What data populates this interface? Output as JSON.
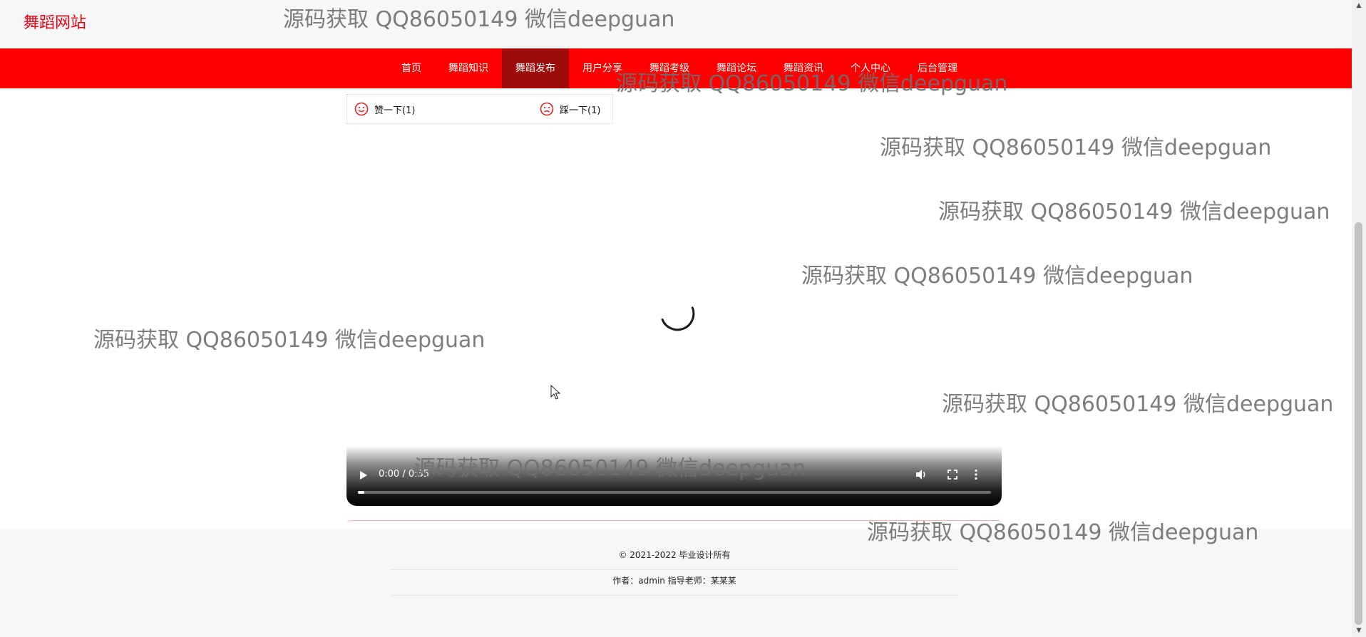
{
  "header": {
    "logo": "舞蹈网站"
  },
  "nav": {
    "items": [
      {
        "label": "首页",
        "active": false
      },
      {
        "label": "舞蹈知识",
        "active": false
      },
      {
        "label": "舞蹈发布",
        "active": true
      },
      {
        "label": "用户分享",
        "active": false
      },
      {
        "label": "舞蹈考级",
        "active": false
      },
      {
        "label": "舞蹈论坛",
        "active": false
      },
      {
        "label": "舞蹈资讯",
        "active": false
      },
      {
        "label": "个人中心",
        "active": false
      },
      {
        "label": "后台管理",
        "active": false
      }
    ]
  },
  "votes": {
    "like_label": "赞一下(1)",
    "dislike_label": "踩一下(1)",
    "icon": "smiley-icon"
  },
  "video": {
    "time": "0:00 / 0:35",
    "progress": 0.01
  },
  "footer": {
    "copyright": "© 2021-2022 毕业设计所有",
    "author": "作者：admin 指导老师：某某某"
  },
  "watermark": {
    "text": "源码获取 QQ86050149 微信deepguan"
  },
  "colors": {
    "brand": "#e60012",
    "nav_bg": "#ff0000",
    "nav_active": "#9e0b0b"
  }
}
